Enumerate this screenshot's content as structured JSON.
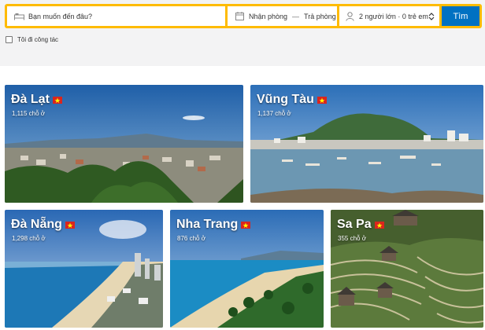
{
  "search": {
    "destination_placeholder": "Bạn muốn đến đâu?",
    "checkin_label": "Nhận phòng",
    "dates_separator": "—",
    "checkout_label": "Trả phòng",
    "guests_value": "2 người lớn · 0 trẻ em",
    "submit_label": "Tìm"
  },
  "work_trip_label": "Tôi đi công tác",
  "destinations": [
    {
      "name": "Đà Lạt",
      "count": "1,115 chỗ ở"
    },
    {
      "name": "Vũng Tàu",
      "count": "1,137 chỗ ở"
    },
    {
      "name": "Đà Nẵng",
      "count": "1,298 chỗ ở"
    },
    {
      "name": "Nha Trang",
      "count": "876 chỗ ở"
    },
    {
      "name": "Sa Pa",
      "count": "355 chỗ ở"
    }
  ],
  "colors": {
    "accent": "#febb02",
    "primary": "#0071c2",
    "flag_red": "#da251d",
    "flag_star": "#ffff00"
  }
}
